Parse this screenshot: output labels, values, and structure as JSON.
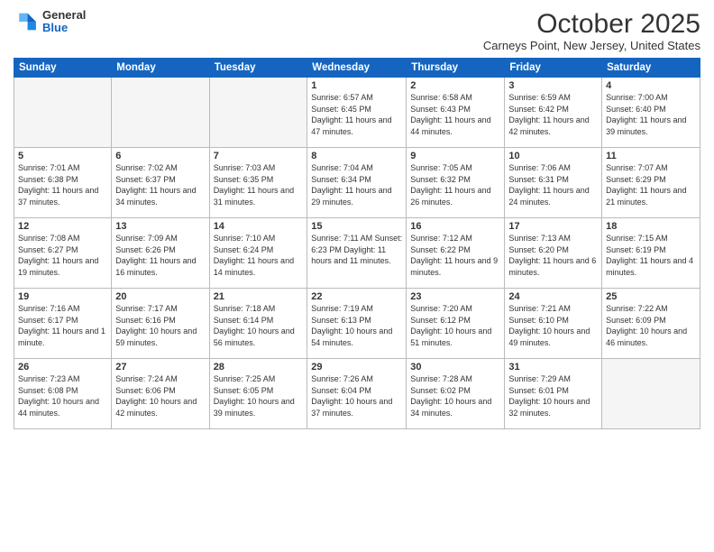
{
  "header": {
    "logo_general": "General",
    "logo_blue": "Blue",
    "month_title": "October 2025",
    "location": "Carneys Point, New Jersey, United States"
  },
  "weekdays": [
    "Sunday",
    "Monday",
    "Tuesday",
    "Wednesday",
    "Thursday",
    "Friday",
    "Saturday"
  ],
  "weeks": [
    [
      {
        "day": "",
        "info": ""
      },
      {
        "day": "",
        "info": ""
      },
      {
        "day": "",
        "info": ""
      },
      {
        "day": "1",
        "info": "Sunrise: 6:57 AM\nSunset: 6:45 PM\nDaylight: 11 hours\nand 47 minutes."
      },
      {
        "day": "2",
        "info": "Sunrise: 6:58 AM\nSunset: 6:43 PM\nDaylight: 11 hours\nand 44 minutes."
      },
      {
        "day": "3",
        "info": "Sunrise: 6:59 AM\nSunset: 6:42 PM\nDaylight: 11 hours\nand 42 minutes."
      },
      {
        "day": "4",
        "info": "Sunrise: 7:00 AM\nSunset: 6:40 PM\nDaylight: 11 hours\nand 39 minutes."
      }
    ],
    [
      {
        "day": "5",
        "info": "Sunrise: 7:01 AM\nSunset: 6:38 PM\nDaylight: 11 hours\nand 37 minutes."
      },
      {
        "day": "6",
        "info": "Sunrise: 7:02 AM\nSunset: 6:37 PM\nDaylight: 11 hours\nand 34 minutes."
      },
      {
        "day": "7",
        "info": "Sunrise: 7:03 AM\nSunset: 6:35 PM\nDaylight: 11 hours\nand 31 minutes."
      },
      {
        "day": "8",
        "info": "Sunrise: 7:04 AM\nSunset: 6:34 PM\nDaylight: 11 hours\nand 29 minutes."
      },
      {
        "day": "9",
        "info": "Sunrise: 7:05 AM\nSunset: 6:32 PM\nDaylight: 11 hours\nand 26 minutes."
      },
      {
        "day": "10",
        "info": "Sunrise: 7:06 AM\nSunset: 6:31 PM\nDaylight: 11 hours\nand 24 minutes."
      },
      {
        "day": "11",
        "info": "Sunrise: 7:07 AM\nSunset: 6:29 PM\nDaylight: 11 hours\nand 21 minutes."
      }
    ],
    [
      {
        "day": "12",
        "info": "Sunrise: 7:08 AM\nSunset: 6:27 PM\nDaylight: 11 hours\nand 19 minutes."
      },
      {
        "day": "13",
        "info": "Sunrise: 7:09 AM\nSunset: 6:26 PM\nDaylight: 11 hours\nand 16 minutes."
      },
      {
        "day": "14",
        "info": "Sunrise: 7:10 AM\nSunset: 6:24 PM\nDaylight: 11 hours\nand 14 minutes."
      },
      {
        "day": "15",
        "info": "Sunrise: 7:11 AM\nSunset: 6:23 PM\nDaylight: 11 hours\nand 11 minutes."
      },
      {
        "day": "16",
        "info": "Sunrise: 7:12 AM\nSunset: 6:22 PM\nDaylight: 11 hours\nand 9 minutes."
      },
      {
        "day": "17",
        "info": "Sunrise: 7:13 AM\nSunset: 6:20 PM\nDaylight: 11 hours\nand 6 minutes."
      },
      {
        "day": "18",
        "info": "Sunrise: 7:15 AM\nSunset: 6:19 PM\nDaylight: 11 hours\nand 4 minutes."
      }
    ],
    [
      {
        "day": "19",
        "info": "Sunrise: 7:16 AM\nSunset: 6:17 PM\nDaylight: 11 hours\nand 1 minute."
      },
      {
        "day": "20",
        "info": "Sunrise: 7:17 AM\nSunset: 6:16 PM\nDaylight: 10 hours\nand 59 minutes."
      },
      {
        "day": "21",
        "info": "Sunrise: 7:18 AM\nSunset: 6:14 PM\nDaylight: 10 hours\nand 56 minutes."
      },
      {
        "day": "22",
        "info": "Sunrise: 7:19 AM\nSunset: 6:13 PM\nDaylight: 10 hours\nand 54 minutes."
      },
      {
        "day": "23",
        "info": "Sunrise: 7:20 AM\nSunset: 6:12 PM\nDaylight: 10 hours\nand 51 minutes."
      },
      {
        "day": "24",
        "info": "Sunrise: 7:21 AM\nSunset: 6:10 PM\nDaylight: 10 hours\nand 49 minutes."
      },
      {
        "day": "25",
        "info": "Sunrise: 7:22 AM\nSunset: 6:09 PM\nDaylight: 10 hours\nand 46 minutes."
      }
    ],
    [
      {
        "day": "26",
        "info": "Sunrise: 7:23 AM\nSunset: 6:08 PM\nDaylight: 10 hours\nand 44 minutes."
      },
      {
        "day": "27",
        "info": "Sunrise: 7:24 AM\nSunset: 6:06 PM\nDaylight: 10 hours\nand 42 minutes."
      },
      {
        "day": "28",
        "info": "Sunrise: 7:25 AM\nSunset: 6:05 PM\nDaylight: 10 hours\nand 39 minutes."
      },
      {
        "day": "29",
        "info": "Sunrise: 7:26 AM\nSunset: 6:04 PM\nDaylight: 10 hours\nand 37 minutes."
      },
      {
        "day": "30",
        "info": "Sunrise: 7:28 AM\nSunset: 6:02 PM\nDaylight: 10 hours\nand 34 minutes."
      },
      {
        "day": "31",
        "info": "Sunrise: 7:29 AM\nSunset: 6:01 PM\nDaylight: 10 hours\nand 32 minutes."
      },
      {
        "day": "",
        "info": ""
      }
    ]
  ]
}
